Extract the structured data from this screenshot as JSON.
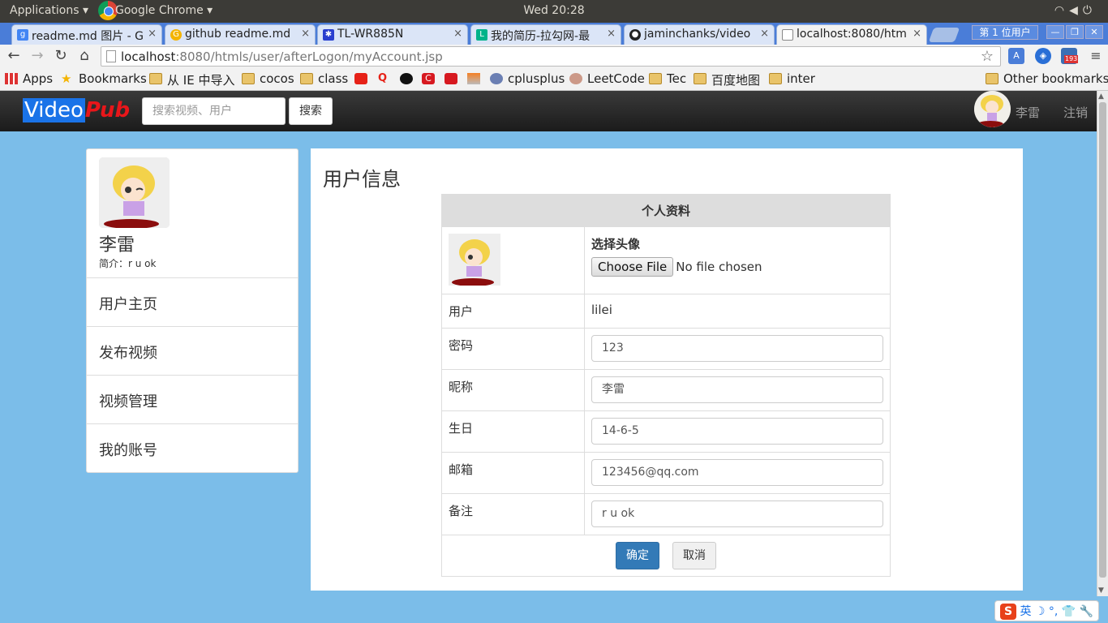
{
  "os": {
    "apps_menu": "Applications ▾",
    "active_app": "Google Chrome ▾",
    "clock": "Wed 20:28",
    "tray_icons": [
      "wifi-icon",
      "volume-icon",
      "power-icon"
    ]
  },
  "browser": {
    "tabs": [
      {
        "title": "readme.md 图片 - G",
        "favicon": "google-icon",
        "color": "#4285f4"
      },
      {
        "title": "github readme.md",
        "favicon": "search-icon",
        "color": "#f4b400"
      },
      {
        "title": "TL-WR885N",
        "favicon": "paw-icon",
        "color": "#2a3fcf"
      },
      {
        "title": "我的简历-拉勾网-最",
        "favicon": "lagou-icon",
        "color": "#00b38a"
      },
      {
        "title": "jaminchanks/video",
        "favicon": "github-icon",
        "color": "#222222"
      },
      {
        "title": "localhost:8080/htm",
        "favicon": "page-icon",
        "color": "#888888"
      }
    ],
    "close_glyph": "×",
    "profile_label": "第 1 位用户",
    "url": {
      "host": "localhost",
      "path": ":8080/htmls/user/afterLogon/myAccount.jsp"
    },
    "extension_badge": "193",
    "bookmarks": [
      {
        "label": "Apps",
        "icon": "apps-grid-icon"
      },
      {
        "label": "Bookmarks",
        "icon": "star-icon"
      },
      {
        "label": "从 IE 中导入",
        "icon": "folder-icon"
      },
      {
        "label": "cocos",
        "icon": "folder-icon"
      },
      {
        "label": "class",
        "icon": "folder-icon"
      },
      {
        "label": "",
        "icon": "youtube-icon"
      },
      {
        "label": "",
        "icon": "q-icon"
      },
      {
        "label": "",
        "icon": "github-icon"
      },
      {
        "label": "",
        "icon": "c-icon"
      },
      {
        "label": "",
        "icon": "red-icon"
      },
      {
        "label": "",
        "icon": "stack-icon"
      },
      {
        "label": "cplusplus",
        "icon": "cplusplus-icon"
      },
      {
        "label": "LeetCode",
        "icon": "leetcode-icon"
      },
      {
        "label": "Tec",
        "icon": "folder-icon"
      },
      {
        "label": "百度地图",
        "icon": "folder-icon"
      },
      {
        "label": "inter",
        "icon": "folder-icon"
      }
    ],
    "other_bookmarks": "Other bookmarks"
  },
  "site": {
    "brand_part1": "Video",
    "brand_part2": "Pub",
    "search_placeholder": "搜索视频、用户",
    "search_button": "搜索",
    "user_name": "李雷",
    "logout": "注销"
  },
  "sidebar": {
    "name": "李雷",
    "bio": "简介：r u ok",
    "items": [
      "用户主页",
      "发布视频",
      "视频管理",
      "我的账号"
    ]
  },
  "account": {
    "title": "用户信息",
    "table_header": "个人资料",
    "avatar_label": "选择头像",
    "file_button": "Choose File",
    "file_status": "No file chosen",
    "user_label": "用户",
    "user_value": "lilei",
    "fields": [
      {
        "label": "密码",
        "value": "123"
      },
      {
        "label": "昵称",
        "value": "李雷"
      },
      {
        "label": "生日",
        "value": "14-6-5"
      },
      {
        "label": "邮箱",
        "value": "123456@qq.com"
      },
      {
        "label": "备注",
        "value": "r u ok"
      }
    ],
    "confirm": "确定",
    "cancel": "取消"
  },
  "ime": {
    "logo": "S",
    "mode": "英"
  },
  "colors": {
    "page_bg": "#7bbde9",
    "brand_blue": "#1a73e8",
    "brand_red": "#e8161a",
    "primary_btn": "#337ab7"
  }
}
